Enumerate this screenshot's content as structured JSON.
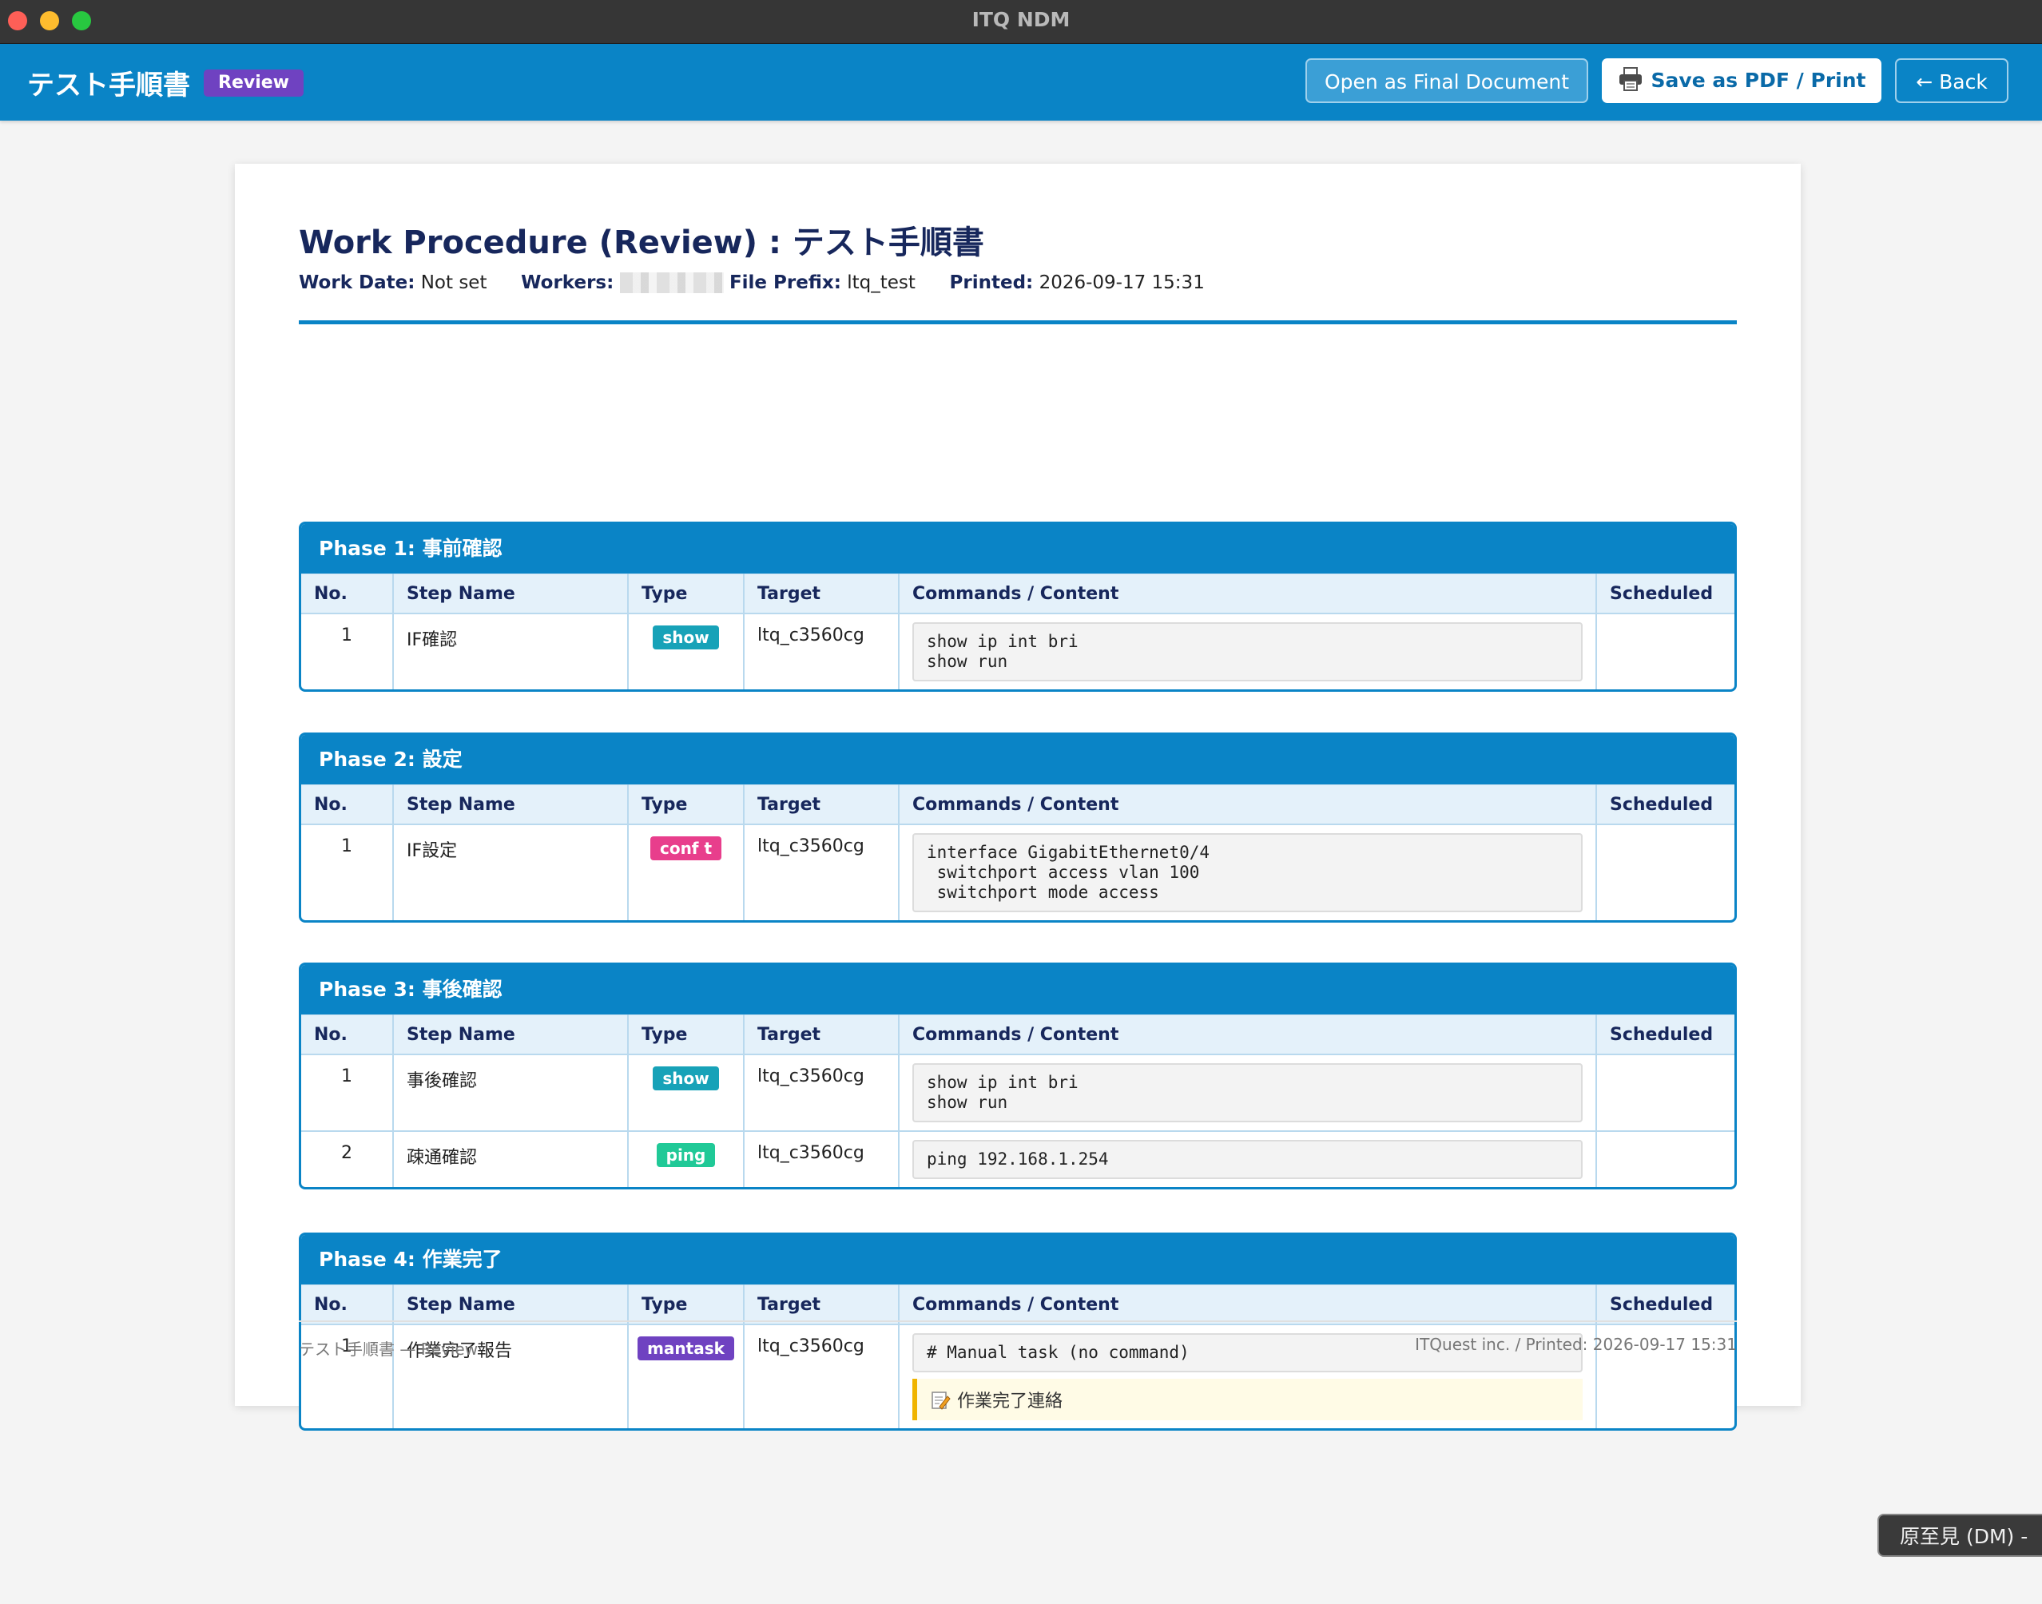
{
  "window": {
    "title": "ITQ NDM"
  },
  "header": {
    "title": "テスト手順書",
    "badge": "Review",
    "open_final_label": "Open as Final Document",
    "print_label": "Save as PDF / Print",
    "back_label": "← Back"
  },
  "doc": {
    "title": "Work Procedure (Review) : テスト手順書",
    "meta": {
      "work_date_label": "Work Date:",
      "work_date": "Not set",
      "workers_label": "Workers:",
      "file_prefix_label": "File Prefix:",
      "file_prefix": "ltq_test",
      "printed_label": "Printed:",
      "printed": "2026-09-17 15:31"
    },
    "columns": [
      "No.",
      "Step Name",
      "Type",
      "Target",
      "Commands / Content",
      "Scheduled"
    ],
    "phases": [
      {
        "title": "Phase 1: 事前確認",
        "rows": [
          {
            "no": "1",
            "name": "IF確認",
            "type": "show",
            "target": "ltq_c3560cg",
            "commands": "show ip int bri\nshow run",
            "scheduled": ""
          }
        ]
      },
      {
        "title": "Phase 2: 設定",
        "rows": [
          {
            "no": "1",
            "name": "IF設定",
            "type": "conf t",
            "target": "ltq_c3560cg",
            "commands": "interface GigabitEthernet0/4\n switchport access vlan 100\n switchport mode access",
            "scheduled": ""
          }
        ]
      },
      {
        "title": "Phase 3: 事後確認",
        "rows": [
          {
            "no": "1",
            "name": "事後確認",
            "type": "show",
            "target": "ltq_c3560cg",
            "commands": "show ip int bri\nshow run",
            "scheduled": ""
          },
          {
            "no": "2",
            "name": "疎通確認",
            "type": "ping",
            "target": "ltq_c3560cg",
            "commands": "ping 192.168.1.254",
            "scheduled": ""
          }
        ]
      },
      {
        "title": "Phase 4: 作業完了",
        "rows": [
          {
            "no": "1",
            "name": "作業完了報告",
            "type": "mantask",
            "target": "ltq_c3560cg",
            "commands": "# Manual task (no command)",
            "note": "作業完了連絡",
            "scheduled": ""
          }
        ]
      }
    ],
    "footer_left": "テスト手順書 — Review",
    "footer_right": "ITQuest inc. / Printed: 2026-09-17 15:31"
  },
  "ime": {
    "label": "原至見 (DM) -"
  },
  "colors": {
    "accent": "#0a84c6",
    "review_badge": "#6f42c1",
    "type_show": "#17a2b8",
    "type_conf": "#e83e8c",
    "type_ping": "#20c997",
    "type_mantask": "#6f42c1"
  },
  "icons": {
    "print": "printer-icon",
    "note": "memo-icon"
  }
}
